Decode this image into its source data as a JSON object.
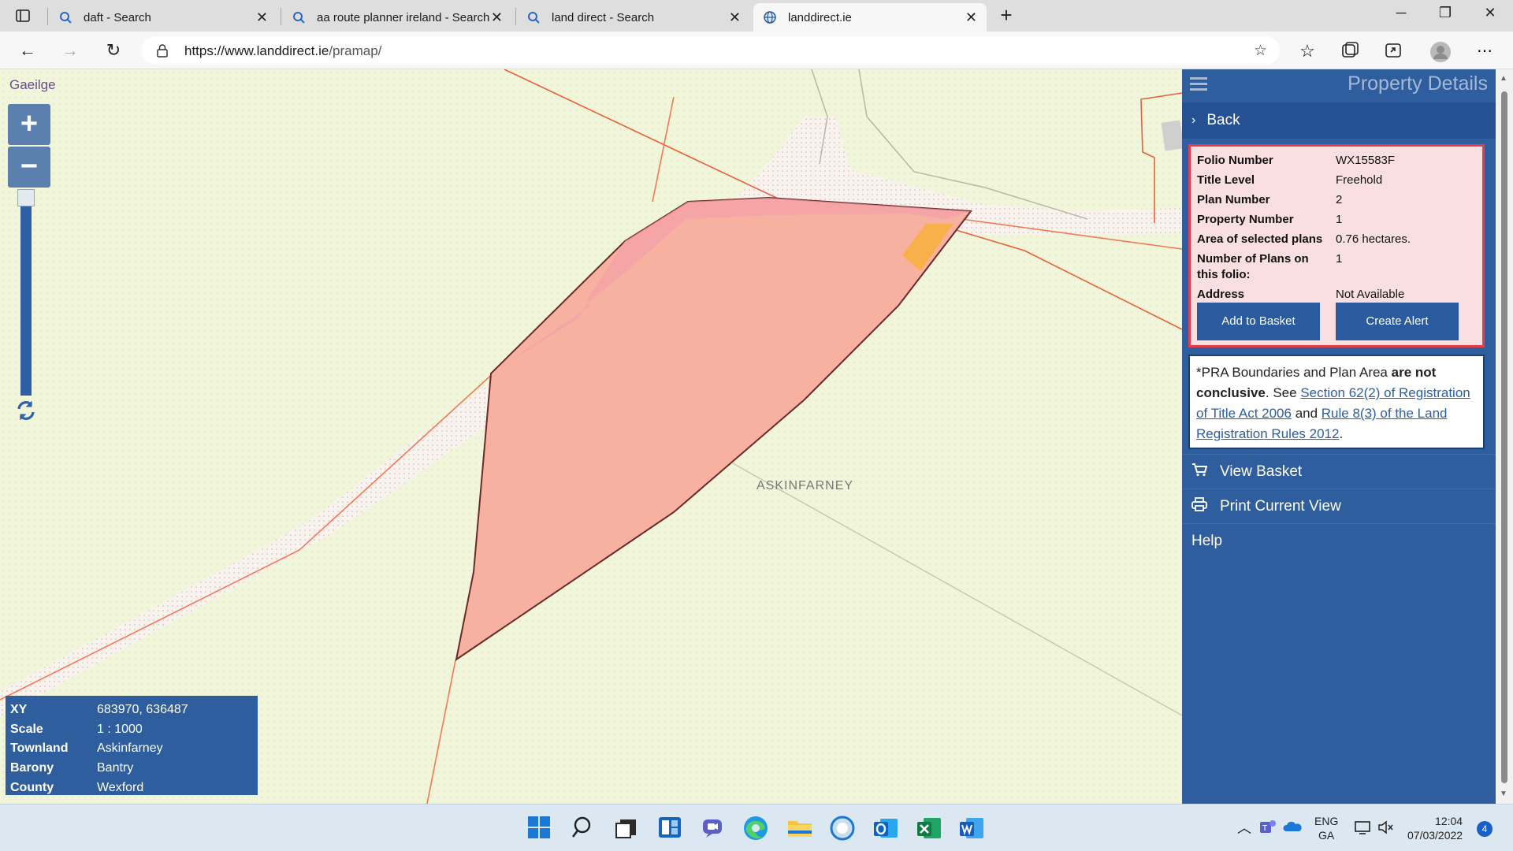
{
  "browser": {
    "tabs": [
      {
        "title": "daft - Search"
      },
      {
        "title": "aa route planner ireland - Search"
      },
      {
        "title": "land direct - Search"
      },
      {
        "title": "landdirect.ie"
      }
    ],
    "url_host": "https://www.landdirect.ie",
    "url_path": "/pramap/"
  },
  "map": {
    "language_link": "Gaeilge",
    "zoom_in": "+",
    "zoom_out": "−",
    "townland_label": "ASKINFARNEY",
    "info": {
      "xy_label": "XY",
      "xy_value": "683970, 636487",
      "scale_label": "Scale",
      "scale_value": "1 : 1000",
      "townland_label": "Townland",
      "townland_value": "Askinfarney",
      "barony_label": "Barony",
      "barony_value": "Bantry",
      "county_label": "County",
      "county_value": "Wexford"
    },
    "colors": {
      "parcel_fill": "#f7b1a1",
      "parcel_border": "#6b2a2a",
      "boundary": "#e8603a",
      "background": "#f1f6da"
    }
  },
  "panel": {
    "title": "Property Details",
    "back": "Back",
    "details": [
      {
        "label": "Folio Number",
        "value": "WX15583F"
      },
      {
        "label": "Title Level",
        "value": "Freehold"
      },
      {
        "label": "Plan Number",
        "value": "2"
      },
      {
        "label": "Property Number",
        "value": "1"
      },
      {
        "label": "Area of selected plans",
        "value": "0.76 hectares."
      },
      {
        "label": "Number of Plans on this folio:",
        "value": "1"
      },
      {
        "label": "Address",
        "value": "Not Available"
      }
    ],
    "add_to_basket": "Add to Basket",
    "create_alert": "Create Alert",
    "disclaimer": {
      "prefix": "*PRA Boundaries and Plan Area ",
      "bold": "are not conclusive",
      "see": ". See ",
      "link1": "Section 62(2) of Registration of Title Act 2006",
      "and": " and ",
      "link2": "Rule 8(3) of the Land Registration Rules 2012",
      "end": "."
    },
    "view_basket": "View Basket",
    "print_view": "Print Current View",
    "help": "Help"
  },
  "taskbar": {
    "lang_top": "ENG",
    "lang_bottom": "GA",
    "time": "12:04",
    "date": "07/03/2022",
    "notifications": "4"
  }
}
